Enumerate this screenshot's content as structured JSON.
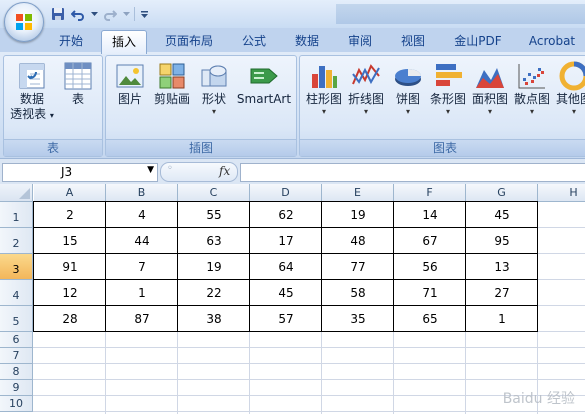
{
  "qat": {
    "save_icon": "save-icon",
    "undo_icon": "undo-icon",
    "redo_icon": "redo-icon",
    "customize_icon": "chevron-down-icon"
  },
  "tabs": [
    {
      "label": "开始",
      "active": false
    },
    {
      "label": "插入",
      "active": true
    },
    {
      "label": "页面布局",
      "active": false
    },
    {
      "label": "公式",
      "active": false
    },
    {
      "label": "数据",
      "active": false
    },
    {
      "label": "审阅",
      "active": false
    },
    {
      "label": "视图",
      "active": false
    },
    {
      "label": "金山PDF",
      "active": false
    },
    {
      "label": "Acrobat",
      "active": false
    }
  ],
  "ribbon": {
    "groups": [
      {
        "label": "表",
        "buttons": [
          {
            "label": "数据\n透视表",
            "has_arrow": true,
            "icon": "pivot-table-icon"
          },
          {
            "label": "表",
            "has_arrow": false,
            "icon": "table-icon"
          }
        ]
      },
      {
        "label": "插图",
        "buttons": [
          {
            "label": "图片",
            "icon": "picture-icon"
          },
          {
            "label": "剪贴画",
            "icon": "clip-art-icon"
          },
          {
            "label": "形状",
            "icon": "shapes-icon",
            "has_arrow": true
          },
          {
            "label": "SmartArt",
            "icon": "smartart-icon"
          }
        ]
      },
      {
        "label": "图表",
        "buttons": [
          {
            "label": "柱形图",
            "icon": "column-chart-icon",
            "has_arrow": true
          },
          {
            "label": "折线图",
            "icon": "line-chart-icon",
            "has_arrow": true
          },
          {
            "label": "饼图",
            "icon": "pie-chart-icon",
            "has_arrow": true
          },
          {
            "label": "条形图",
            "icon": "bar-chart-icon",
            "has_arrow": true
          },
          {
            "label": "面积图",
            "icon": "area-chart-icon",
            "has_arrow": true
          },
          {
            "label": "散点图",
            "icon": "scatter-chart-icon",
            "has_arrow": true
          },
          {
            "label": "其他图",
            "icon": "other-charts-icon",
            "has_arrow": true
          }
        ]
      }
    ]
  },
  "formula_bar": {
    "name_box": "J3",
    "fx_label": "fx",
    "formula": ""
  },
  "sheet": {
    "columns": [
      "A",
      "B",
      "C",
      "D",
      "E",
      "F",
      "G",
      "H"
    ],
    "rows": [
      "1",
      "2",
      "3",
      "4",
      "5",
      "6",
      "7",
      "8",
      "9",
      "10"
    ],
    "selected_row": "3",
    "data": [
      [
        "2",
        "4",
        "55",
        "62",
        "19",
        "14",
        "45"
      ],
      [
        "15",
        "44",
        "63",
        "17",
        "48",
        "67",
        "95"
      ],
      [
        "91",
        "7",
        "19",
        "64",
        "77",
        "56",
        "13"
      ],
      [
        "12",
        "1",
        "22",
        "45",
        "58",
        "71",
        "27"
      ],
      [
        "28",
        "87",
        "38",
        "57",
        "35",
        "65",
        "1"
      ]
    ]
  },
  "watermark": "Baidu 经验"
}
